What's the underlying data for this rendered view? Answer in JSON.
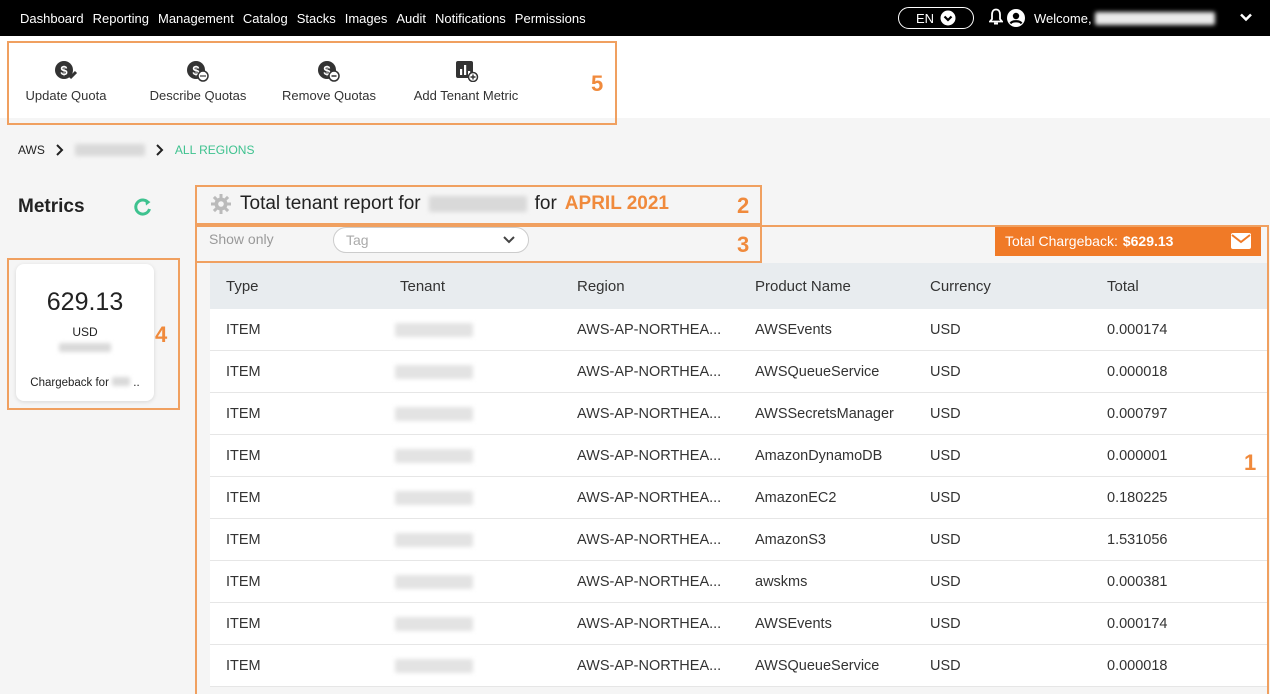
{
  "nav": {
    "items": [
      "Dashboard",
      "Reporting",
      "Management",
      "Catalog",
      "Stacks",
      "Images",
      "Audit",
      "Notifications",
      "Permissions"
    ],
    "language": "EN",
    "welcome": "Welcome,"
  },
  "toolbar": {
    "update_quota": "Update Quota",
    "describe_quotas": "Describe Quotas",
    "remove_quotas": "Remove Quotas",
    "add_tenant_metric": "Add Tenant Metric"
  },
  "breadcrumb": {
    "root": "AWS",
    "last": "ALL REGIONS"
  },
  "metrics": {
    "title": "Metrics",
    "card_value": "629.13",
    "card_currency": "USD",
    "card_label": "Chargeback for"
  },
  "report": {
    "prefix": "Total tenant report for",
    "middle": "for",
    "month": "APRIL 2021"
  },
  "filter": {
    "show_only": "Show only",
    "tag_placeholder": "Tag"
  },
  "chargeback": {
    "label": "Total Chargeback:",
    "value": "$629.13"
  },
  "table": {
    "headers": [
      "Type",
      "Tenant",
      "Region",
      "Product Name",
      "Currency",
      "Total"
    ],
    "rows": [
      {
        "type": "ITEM",
        "region": "AWS-AP-NORTHEA...",
        "product": "AWSEvents",
        "currency": "USD",
        "total": "0.000174"
      },
      {
        "type": "ITEM",
        "region": "AWS-AP-NORTHEA...",
        "product": "AWSQueueService",
        "currency": "USD",
        "total": "0.000018"
      },
      {
        "type": "ITEM",
        "region": "AWS-AP-NORTHEA...",
        "product": "AWSSecretsManager",
        "currency": "USD",
        "total": "0.000797"
      },
      {
        "type": "ITEM",
        "region": "AWS-AP-NORTHEA...",
        "product": "AmazonDynamoDB",
        "currency": "USD",
        "total": "0.000001"
      },
      {
        "type": "ITEM",
        "region": "AWS-AP-NORTHEA...",
        "product": "AmazonEC2",
        "currency": "USD",
        "total": "0.180225"
      },
      {
        "type": "ITEM",
        "region": "AWS-AP-NORTHEA...",
        "product": "AmazonS3",
        "currency": "USD",
        "total": "1.531056"
      },
      {
        "type": "ITEM",
        "region": "AWS-AP-NORTHEA...",
        "product": "awskms",
        "currency": "USD",
        "total": "0.000381"
      },
      {
        "type": "ITEM",
        "region": "AWS-AP-NORTHEA...",
        "product": "AWSEvents",
        "currency": "USD",
        "total": "0.000174"
      },
      {
        "type": "ITEM",
        "region": "AWS-AP-NORTHEA...",
        "product": "AWSQueueService",
        "currency": "USD",
        "total": "0.000018"
      }
    ]
  },
  "annotations": [
    "1",
    "2",
    "3",
    "4",
    "5"
  ],
  "colors": {
    "accent": "#f07a27",
    "highlight": "#f0a060",
    "green": "#3ec28f"
  }
}
